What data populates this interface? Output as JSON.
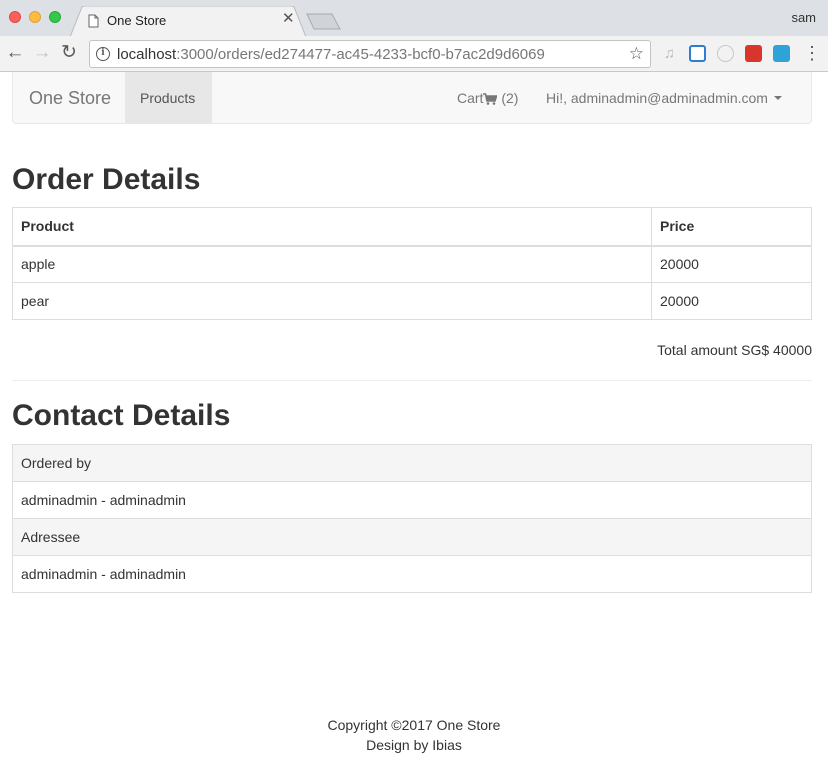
{
  "browser": {
    "tab_title": "One Store",
    "profile_name": "sam",
    "url_host": "localhost",
    "url_path": ":3000/orders/ed274477-ac45-4233-bcf0-b7ac2d9d6069"
  },
  "navbar": {
    "brand": "One Store",
    "products_label": "Products",
    "cart_label": "Cart",
    "cart_count": "(2)",
    "user_greeting": "Hi!, adminadmin@adminadmin.com"
  },
  "order": {
    "heading": "Order Details",
    "columns": [
      "Product",
      "Price"
    ],
    "rows": [
      {
        "product": "apple",
        "price": "20000"
      },
      {
        "product": "pear",
        "price": "20000"
      }
    ],
    "total_label": "Total amount SG$ 40000"
  },
  "contact": {
    "heading": "Contact Details",
    "ordered_by_label": "Ordered by",
    "ordered_by_value": "adminadmin - adminadmin",
    "adressee_label": "Adressee",
    "adressee_value": "adminadmin - adminadmin"
  },
  "footer": {
    "copyright": "Copyright ©2017 One Store",
    "design": "Design by Ibias"
  }
}
